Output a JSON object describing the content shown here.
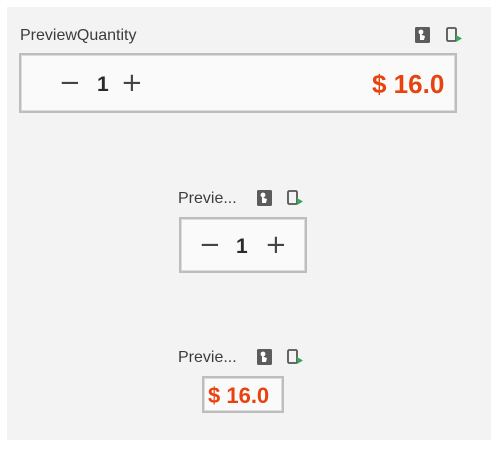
{
  "previews": [
    {
      "title": "PreviewQuantity",
      "decrement": "−",
      "quantity": "1",
      "increment": "+",
      "price": "$ 16.0"
    },
    {
      "title": "Previe...",
      "decrement": "−",
      "quantity": "1",
      "increment": "+"
    },
    {
      "title": "Previe...",
      "price": "$ 16.0"
    }
  ],
  "icons": {
    "interactive": "interactive-mode-icon",
    "deploy": "deploy-to-device-icon"
  },
  "colors": {
    "price": "#e8420f",
    "deploy_arrow": "#3aa657",
    "panel_bg": "#f3f3f3",
    "frame_border": "#bdbdbd"
  }
}
